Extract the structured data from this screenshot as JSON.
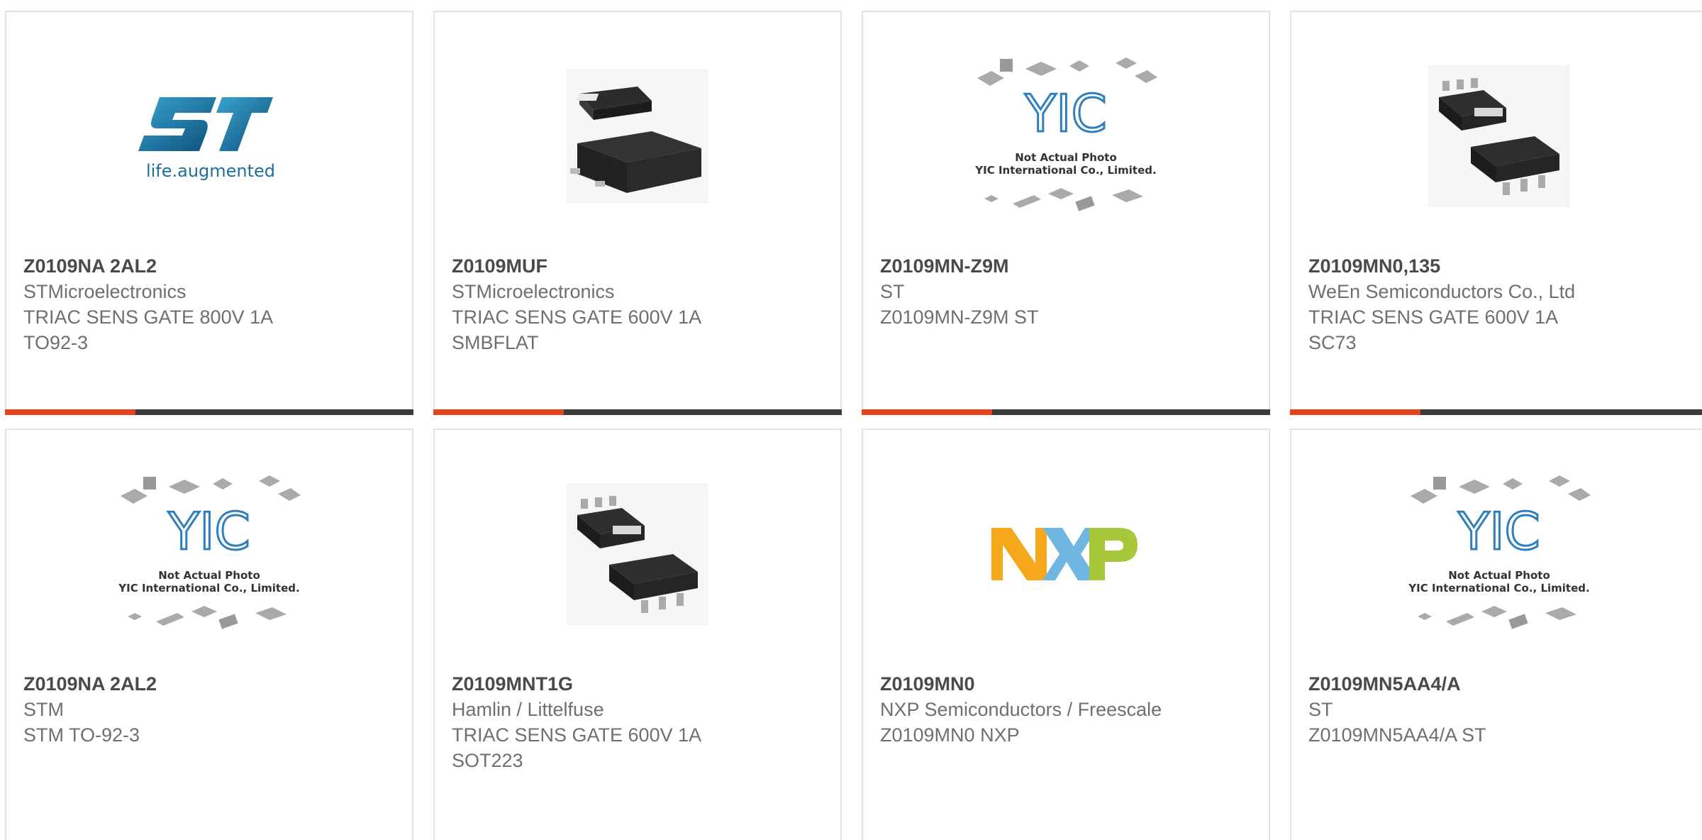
{
  "colors": {
    "accent": "#e8421c",
    "bar": "#3a3a3a",
    "part_text": "#4a4a4a",
    "meta_text": "#6f6f6f"
  },
  "products": [
    {
      "part": "Z0109NA 2AL2",
      "lines": [
        "STMicroelectronics",
        "TRIAC SENS GATE 800V 1A",
        "TO92-3"
      ],
      "image": "st-logo"
    },
    {
      "part": "Z0109MUF",
      "lines": [
        "STMicroelectronics",
        "TRIAC SENS GATE 600V 1A",
        "SMBFLAT"
      ],
      "image": "smbflat-package"
    },
    {
      "part": "Z0109MN-Z9M",
      "lines": [
        "ST",
        "Z0109MN-Z9M ST"
      ],
      "image": "yic-placeholder"
    },
    {
      "part": "Z0109MN0,135",
      "lines": [
        "WeEn Semiconductors Co., Ltd",
        "TRIAC SENS GATE 600V 1A",
        "SC73"
      ],
      "image": "sot223-package"
    },
    {
      "part": "Z0109NA 2AL2",
      "lines": [
        "STM",
        "STM TO-92-3"
      ],
      "image": "yic-placeholder"
    },
    {
      "part": "Z0109MNT1G",
      "lines": [
        "Hamlin / Littelfuse",
        "TRIAC SENS GATE 600V 1A",
        "SOT223"
      ],
      "image": "sot223-package"
    },
    {
      "part": "Z0109MN0",
      "lines": [
        "NXP Semiconductors / Freescale",
        "Z0109MN0 NXP"
      ],
      "image": "nxp-logo"
    },
    {
      "part": "Z0109MN5AA4/A",
      "lines": [
        "ST",
        "Z0109MN5AA4/A ST"
      ],
      "image": "yic-placeholder"
    }
  ],
  "logos": {
    "st_tagline": "life.augmented",
    "yic_line1": "Not Actual Photo",
    "yic_line2": "YIC International Co., Limited.",
    "nxp": [
      "N",
      "X",
      "P"
    ]
  }
}
